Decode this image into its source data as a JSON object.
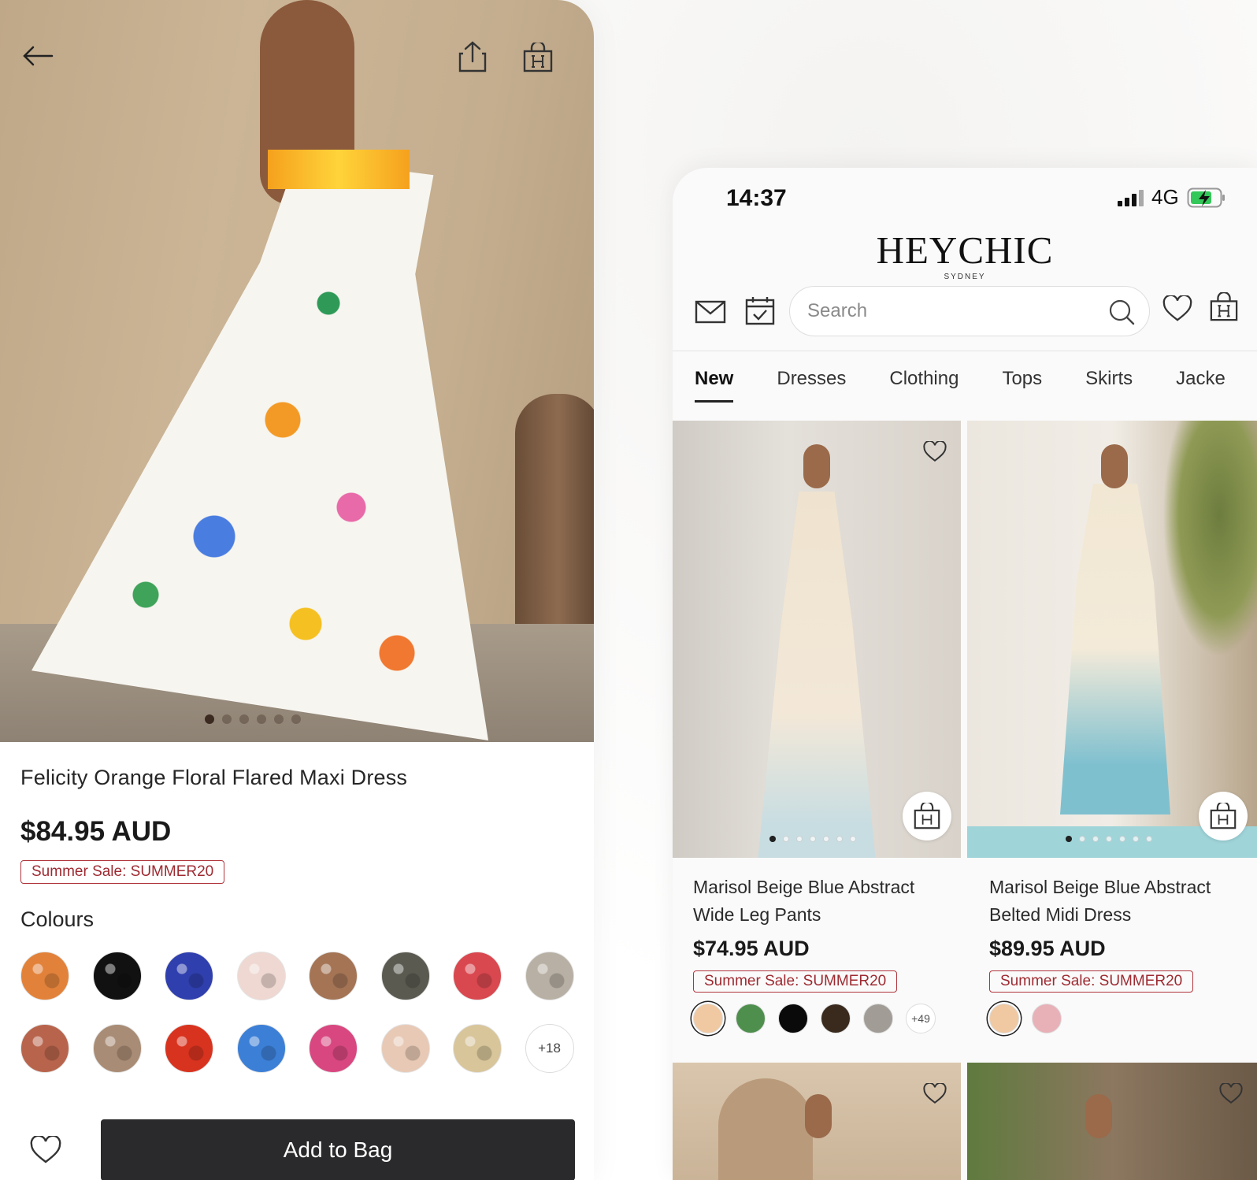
{
  "detail": {
    "title": "Felicity Orange Floral Flared Maxi Dress",
    "price": "$84.95 AUD",
    "promo": "Summer Sale: SUMMER20",
    "colours_label": "Colours",
    "more_colours": "+18",
    "add_to_bag": "Add to Bag",
    "image_pages": 6,
    "image_active": 0,
    "swatch_colors": [
      "#e2823a",
      "#111111",
      "#2f3fae",
      "#efd8d2",
      "#a47455",
      "#5a5a50",
      "#d9474f",
      "#b8b0a4",
      "#b8644c",
      "#a98c75",
      "#d8331f",
      "#3c7fd6",
      "#d84780",
      "#e8c9b5",
      "#d8c59a"
    ]
  },
  "status": {
    "time": "14:37",
    "network": "4G"
  },
  "brand": {
    "name": "HEYCHIC",
    "sub": "SYDNEY"
  },
  "search": {
    "placeholder": "Search"
  },
  "tabs": [
    "New",
    "Dresses",
    "Clothing",
    "Tops",
    "Skirts",
    "Jacke"
  ],
  "products": [
    {
      "name": "Marisol Beige Blue Abstract Wide Leg Pants",
      "price": "$74.95 AUD",
      "promo": "Summer Sale: SUMMER20",
      "more_colours": "+49",
      "swatches": [
        "#f0c9a2",
        "#4f8f4e",
        "#0a0a0a",
        "#3a2a1e",
        "#a19d96"
      ]
    },
    {
      "name": "Marisol Beige Blue Abstract Belted Midi Dress",
      "price": "$89.95 AUD",
      "promo": "Summer Sale: SUMMER20",
      "swatches": [
        "#f0c9a2",
        "#e8b1b8"
      ]
    }
  ],
  "colors": {
    "accent_red": "#b0343b",
    "button_dark": "#2a2a2c"
  }
}
